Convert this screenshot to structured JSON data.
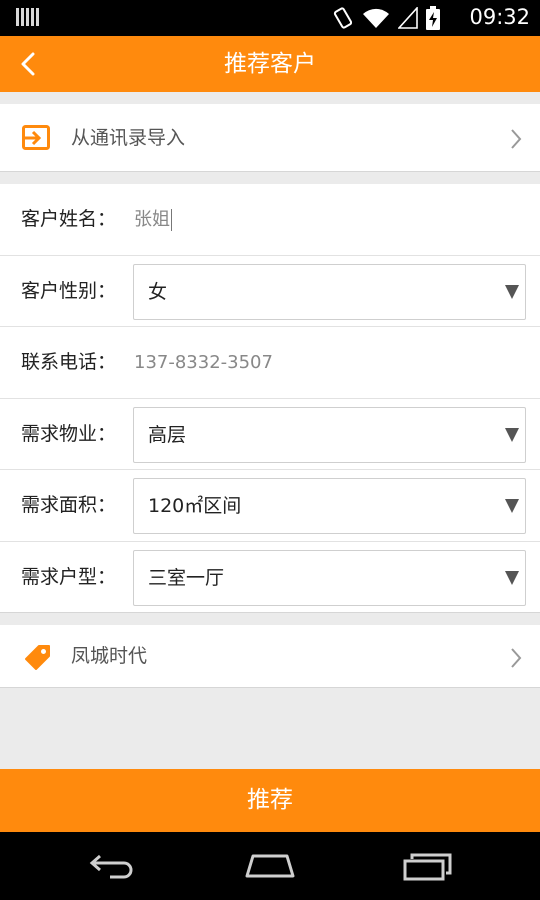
{
  "status_bar": {
    "time": "09:32"
  },
  "header": {
    "title": "推荐客户"
  },
  "import_row": {
    "label": "从通讯录导入"
  },
  "form": {
    "name": {
      "label": "客户姓名：",
      "value": "张姐"
    },
    "gender": {
      "label": "客户性别：",
      "value": "女"
    },
    "phone": {
      "label": "联系电话：",
      "value": "137-8332-3507"
    },
    "property": {
      "label": "需求物业：",
      "value": "高层"
    },
    "area": {
      "label": "需求面积：",
      "value": "120㎡区间"
    },
    "layout": {
      "label": "需求户型：",
      "value": "三室一厅"
    }
  },
  "project_row": {
    "label": "凤城时代"
  },
  "submit": {
    "label": "推荐"
  },
  "colors": {
    "accent": "#ff8a0d",
    "background": "#ebebeb"
  }
}
